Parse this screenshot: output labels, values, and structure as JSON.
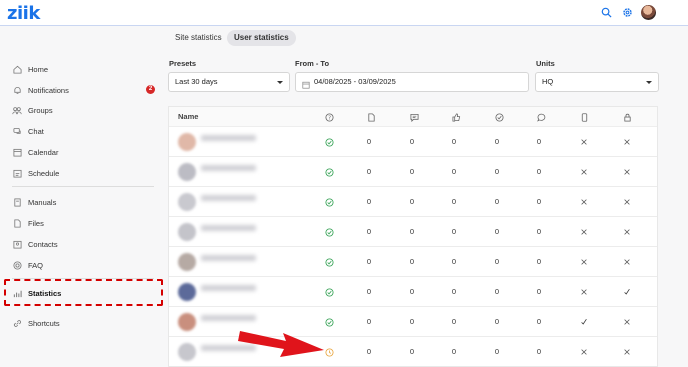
{
  "app": {
    "logo": "ziik"
  },
  "topbar": {
    "icons": [
      "search-icon",
      "gear-icon",
      "help-icon"
    ]
  },
  "tabs": [
    {
      "label": "Site statistics",
      "active": false
    },
    {
      "label": "User statistics",
      "active": true
    }
  ],
  "sidebar": {
    "items": [
      {
        "label": "Home",
        "icon": "home-icon"
      },
      {
        "label": "Notifications",
        "icon": "bell-icon",
        "badge": "2"
      },
      {
        "label": "Groups",
        "icon": "groups-icon"
      },
      {
        "label": "Chat",
        "icon": "chat-icon"
      },
      {
        "label": "Calendar",
        "icon": "calendar-icon"
      },
      {
        "label": "Schedule",
        "icon": "schedule-icon"
      },
      {
        "label": "Manuals",
        "icon": "manual-icon"
      },
      {
        "label": "Files",
        "icon": "file-icon"
      },
      {
        "label": "Contacts",
        "icon": "contacts-icon"
      },
      {
        "label": "FAQ",
        "icon": "faq-icon"
      },
      {
        "label": "Statistics",
        "icon": "stats-icon",
        "active": true
      },
      {
        "label": "Shortcuts",
        "icon": "link-icon"
      }
    ]
  },
  "filters": {
    "presets": {
      "label": "Presets",
      "value": "Last 30 days"
    },
    "range": {
      "label": "From - To",
      "value": "04/08/2025 - 03/09/2025"
    },
    "units": {
      "label": "Units",
      "value": "HQ"
    }
  },
  "table": {
    "name_header": "Name",
    "column_icons": [
      "help-icon",
      "page-icon",
      "message-icon",
      "like-icon",
      "check-circle-icon",
      "comment-icon",
      "phone-icon",
      "lock-icon"
    ],
    "rows": [
      {
        "status": "ok",
        "values": [
          "0",
          "0",
          "0",
          "0",
          "0"
        ],
        "phone": "x",
        "lock": "x"
      },
      {
        "status": "ok",
        "values": [
          "0",
          "0",
          "0",
          "0",
          "0"
        ],
        "phone": "x",
        "lock": "x"
      },
      {
        "status": "ok",
        "values": [
          "0",
          "0",
          "0",
          "0",
          "0"
        ],
        "phone": "x",
        "lock": "x"
      },
      {
        "status": "ok",
        "values": [
          "0",
          "0",
          "0",
          "0",
          "0"
        ],
        "phone": "x",
        "lock": "x"
      },
      {
        "status": "ok",
        "values": [
          "0",
          "0",
          "0",
          "0",
          "0"
        ],
        "phone": "x",
        "lock": "x"
      },
      {
        "status": "ok",
        "values": [
          "0",
          "0",
          "0",
          "0",
          "0"
        ],
        "phone": "x",
        "lock": "check"
      },
      {
        "status": "ok",
        "values": [
          "0",
          "0",
          "0",
          "0",
          "0"
        ],
        "phone": "check",
        "lock": "x"
      },
      {
        "status": "pending",
        "values": [
          "0",
          "0",
          "0",
          "0",
          "0"
        ],
        "phone": "x",
        "lock": "x"
      }
    ]
  },
  "colors": {
    "accent": "#1a73e8",
    "ok": "#2e9e4f",
    "pending": "#e8a33a",
    "highlight": "#d40000"
  }
}
